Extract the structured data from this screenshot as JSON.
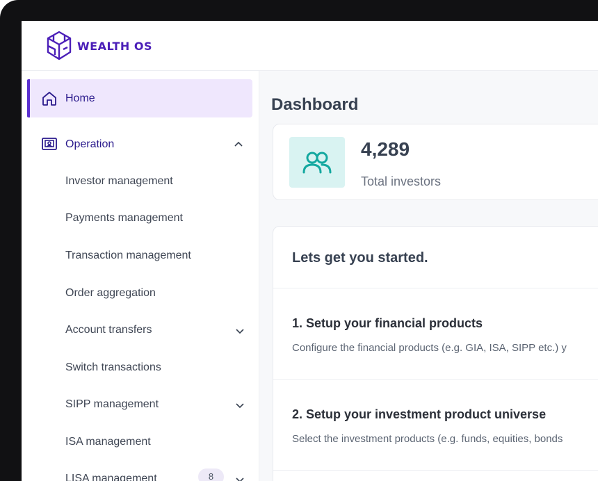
{
  "brand": {
    "name": "WEALTH OS",
    "color": "#4b1fb8"
  },
  "sidebar": {
    "items": [
      {
        "label": "Home",
        "icon": "home-icon",
        "active": true
      },
      {
        "label": "Operation",
        "icon": "operation-icon",
        "expanded": true
      }
    ],
    "subitems": [
      {
        "label": "Investor management"
      },
      {
        "label": "Payments management"
      },
      {
        "label": "Transaction management"
      },
      {
        "label": "Order aggregation"
      },
      {
        "label": "Account transfers",
        "has_children": true
      },
      {
        "label": "Switch transactions"
      },
      {
        "label": "SIPP management",
        "has_children": true
      },
      {
        "label": "ISA management"
      },
      {
        "label": "LISA management",
        "badge": "8",
        "has_children": true
      }
    ]
  },
  "main": {
    "title": "Dashboard",
    "stat": {
      "value": "4,289",
      "label": "Total investors",
      "icon": "users-icon"
    },
    "getting_started": {
      "title": "Lets get you started.",
      "steps": [
        {
          "title": "1. Setup your financial products",
          "description": "Configure the financial products (e.g. GIA, ISA, SIPP etc.) y"
        },
        {
          "title": "2. Setup your investment product universe",
          "description": "Select the investment products (e.g. funds, equities, bonds"
        }
      ]
    }
  },
  "colors": {
    "accent": "#5b2fd0",
    "active_bg": "#efe7fd",
    "teal": "#14a8a0",
    "teal_bg": "#d9f3f2"
  }
}
